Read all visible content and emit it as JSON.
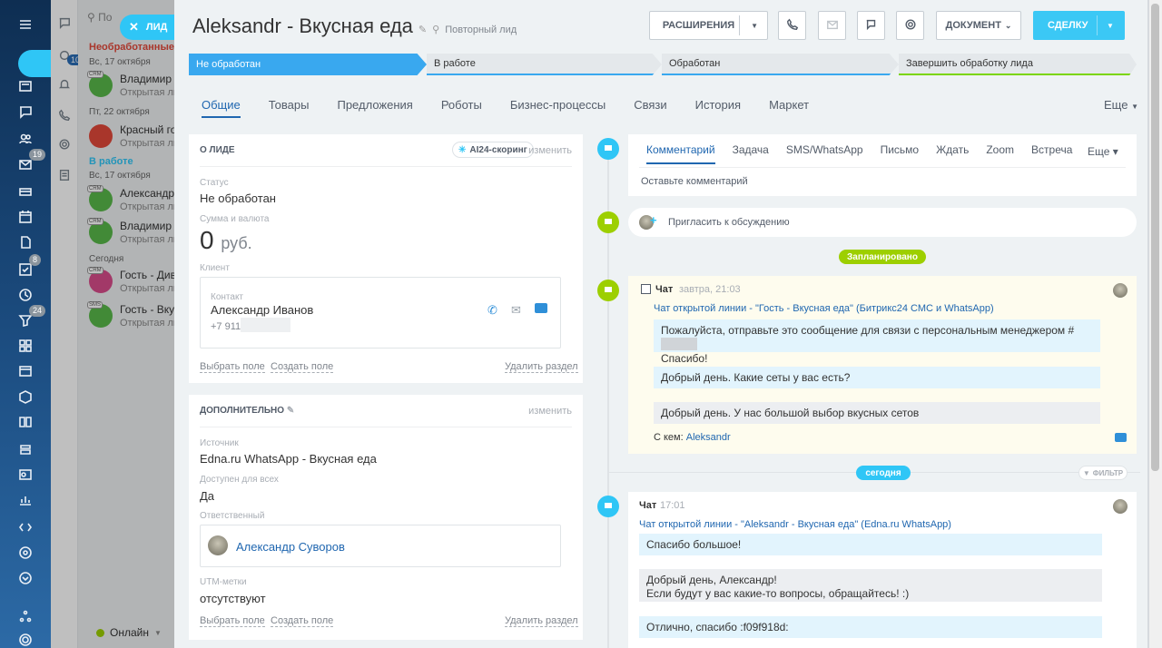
{
  "leftbar": {
    "badges": {
      "chats": "10",
      "mail": "19",
      "tasks": "8",
      "crm": "24"
    }
  },
  "dialogs": {
    "search_placeholder": "По",
    "groups": [
      {
        "title": "Необработанные",
        "date1": "Вс, 17 октября",
        "date2": "Пт, 22 октября"
      },
      {
        "title": "В работе",
        "date1": "Вс, 17 октября",
        "date2": "Сегодня"
      }
    ],
    "items": [
      {
        "name": "Владимир П",
        "sub": "Открытая ли"
      },
      {
        "name": "Красный го",
        "sub": "Открытая ли"
      },
      {
        "name": "Александр",
        "sub": "Открытая ли"
      },
      {
        "name": "Владимир П",
        "sub": "Открытая ли"
      },
      {
        "name": "Гость - Дива",
        "sub": "Открытая ли"
      },
      {
        "name": "Гость - Вкус",
        "sub": "Открытая ли"
      }
    ],
    "crm_tag": "CRM",
    "sms_tag": "SMS",
    "status": "Онлайн"
  },
  "lead_tab": "ЛИД",
  "header": {
    "title": "Aleksandr - Вкусная  еда",
    "subtitle": "Повторный лид",
    "extensions_label": "РАСШИРЕНИЯ",
    "document_label": "ДОКУМЕНТ",
    "deal_label": "СДЕЛКУ"
  },
  "stages": [
    {
      "label": "Не обработан",
      "color": "#39a8ef"
    },
    {
      "label": "В работе",
      "color": "#39a8ef"
    },
    {
      "label": "Обработан",
      "color": "#39a8ef"
    },
    {
      "label": "Завершить обработку лида",
      "color": "#7bd500"
    }
  ],
  "tabs": [
    "Общие",
    "Товары",
    "Предложения",
    "Роботы",
    "Бизнес-процессы",
    "Связи",
    "История",
    "Маркет"
  ],
  "tabs_more": "Еще",
  "about": {
    "heading": "О ЛИДЕ",
    "ai_label": "AI24-скоринг",
    "edit_label": "изменить",
    "status_label": "Статус",
    "status_value": "Не обработан",
    "sum_label": "Сумма и валюта",
    "sum_value": "0",
    "currency": "руб.",
    "client_label": "Клиент",
    "contact_label": "Контакт",
    "contact_name": "Александр Иванов",
    "contact_phone": "+7 911",
    "select_field": "Выбрать поле",
    "create_field": "Создать поле",
    "delete_section": "Удалить раздел"
  },
  "extra": {
    "heading": "ДОПОЛНИТЕЛЬНО",
    "edit_label": "изменить",
    "source_label": "Источник",
    "source_value": "Edna.ru WhatsApp - Вкусная еда",
    "available_label": "Доступен для всех",
    "available_value": "Да",
    "responsible_label": "Ответственный",
    "responsible_value": "Александр Суворов",
    "utm_label": "UTM-метки",
    "utm_value": "отсутствуют",
    "select_field": "Выбрать поле",
    "create_field": "Создать поле",
    "delete_section": "Удалить раздел"
  },
  "composer": {
    "tabs": [
      "Комментарий",
      "Задача",
      "SMS/WhatsApp",
      "Письмо",
      "Ждать",
      "Zoom",
      "Встреча"
    ],
    "more": "Еще",
    "placeholder": "Оставьте комментарий",
    "invite": "Пригласить к обсуждению"
  },
  "planned": {
    "pill": "Запланировано",
    "chat_label": "Чат",
    "time": "завтра, 21:03",
    "line": "Чат открытой линии - \"Гость - Вкусная еда\" (Битрикс24 СМС и WhatsApp)",
    "msg1a": "Пожалуйста, отправьте это сообщение для связи с персональным менеджером #",
    "msg1b": "Спасибо!",
    "msg2": "Добрый день. Какие сеты у вас есть?",
    "msg3": "Добрый день. У нас большой выбор вкусных сетов",
    "with_label": "С кем:",
    "with_name": "Aleksandr"
  },
  "today": {
    "pill": "сегодня",
    "filter": "ФИЛЬТР",
    "chat_label": "Чат",
    "time": "17:01",
    "line": "Чат открытой линии - \"Aleksandr - Вкусная еда\" (Edna.ru WhatsApp)",
    "msg1": "Спасибо большое!",
    "msg2a": "Добрый день, Александр!",
    "msg2b": "Если будут у вас какие-то вопросы, обращайтесь! :)",
    "msg3": "Отлично, спасибо :f09f918d:"
  },
  "colors": {
    "accent": "#2fc6f6",
    "link": "#2067b0",
    "green": "#9dcf00"
  }
}
